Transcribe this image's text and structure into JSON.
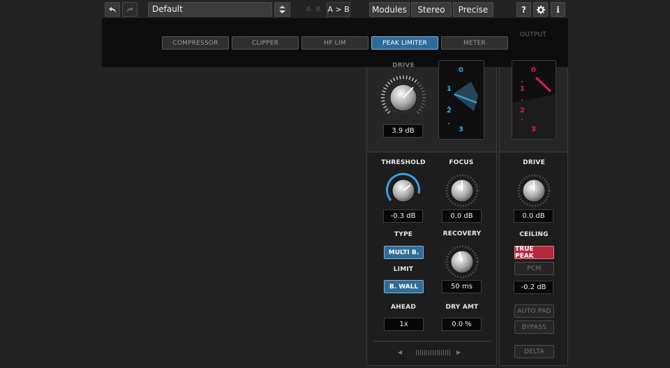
{
  "topbar": {
    "undo_icon": "undo-icon",
    "redo_icon": "redo-icon",
    "preset_value": "Default",
    "ab_a": "A",
    "ab_b": "B",
    "ab_copy": "A > B",
    "modules": "Modules",
    "stereo": "Stereo",
    "precise": "Precise",
    "help": "?",
    "settings_icon": "gear-icon",
    "info": "i"
  },
  "module_tabs": [
    "COMPRESSOR",
    "CLIPPER",
    "HF LIM",
    "PEAK LIMITER",
    "METER"
  ],
  "active_module": "PEAK LIMITER",
  "limiter": {
    "drive_label": "DRIVE",
    "drive_value": "3.9 dB",
    "meter_scale": [
      "0",
      "1",
      "2",
      "3"
    ],
    "threshold_label": "THRESHOLD",
    "threshold_value": "-0.3 dB",
    "focus_label": "FOCUS",
    "focus_value": "0.0 dB",
    "type_label": "TYPE",
    "type_value": "MULTI B.",
    "recovery_label": "RECOVERY",
    "recovery_value": "50 ms",
    "limit_label": "LIMIT",
    "limit_value": "B. WALL",
    "ahead_label": "AHEAD",
    "ahead_value": "1x",
    "dry_label": "DRY AMT",
    "dry_value": "0.0 %"
  },
  "output": {
    "title": "OUTPUT",
    "meter_scale": [
      "0",
      "1",
      "2",
      "3"
    ],
    "drive_label": "DRIVE",
    "drive_value": "0.0 dB",
    "ceiling_label": "CEILING",
    "true_peak": "TRUE PEAK",
    "pcm": "PCM",
    "ceiling_value": "-0.2 dB",
    "auto_pad": "AUTO PAD",
    "bypass": "BYPASS",
    "delta": "DELTA"
  },
  "colors": {
    "accent_blue": "#2f6c97",
    "meter_blue": "#3aa0e0",
    "meter_red": "#e8175d",
    "true_peak_red": "#b6273f"
  }
}
